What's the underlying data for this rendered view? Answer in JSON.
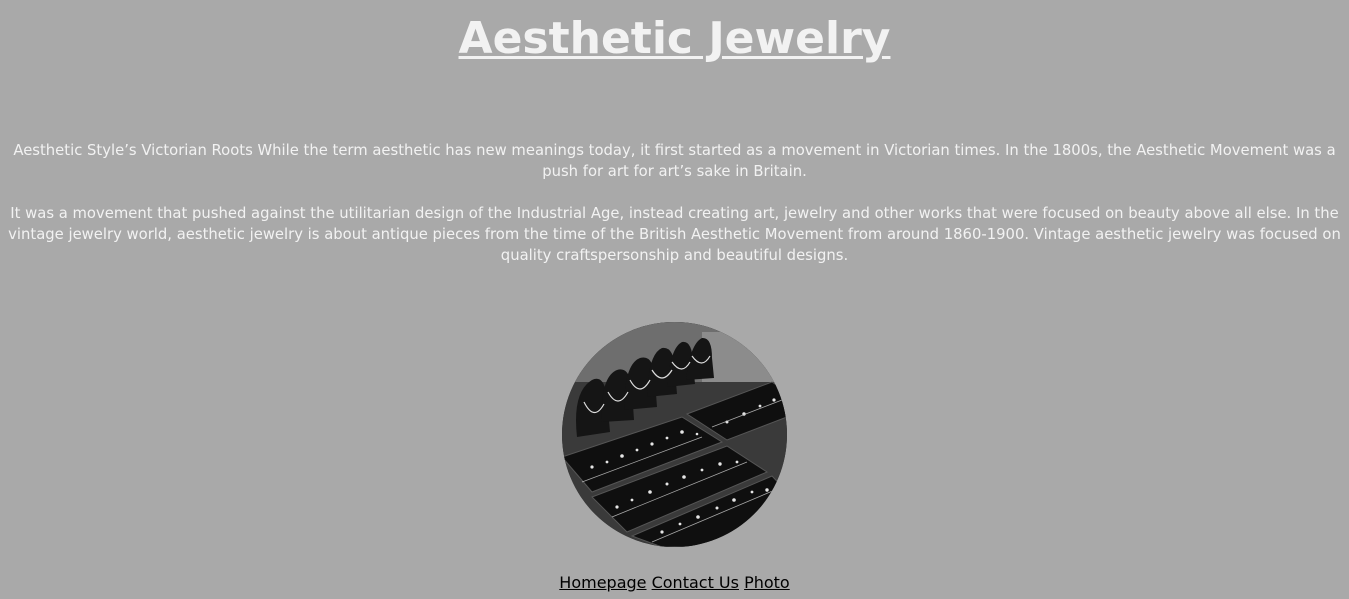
{
  "page": {
    "title": "Aesthetic Jewelry"
  },
  "content": {
    "paragraph_1": "Aesthetic Style’s Victorian Roots While the term aesthetic has new meanings today, it first started as a movement in Victorian times. In the 1800s, the Aesthetic Movement was a push for art for art’s sake in Britain.",
    "paragraph_2": "It was a movement that pushed against the utilitarian design of the Industrial Age, instead creating art, jewelry and other works that were focused on beauty above all else. In the vintage jewelry world, aesthetic jewelry is about antique pieces from the time of the British Aesthetic Movement from around 1860-1900. Vintage aesthetic jewelry was focused on quality craftspersonship and beautiful designs."
  },
  "nav": {
    "links": [
      {
        "label": "Homepage"
      },
      {
        "label": "Contact Us"
      },
      {
        "label": "Photo"
      }
    ]
  },
  "colors": {
    "background": "#a9a9a9",
    "text": "#f2f2f2",
    "link": "#000000"
  }
}
